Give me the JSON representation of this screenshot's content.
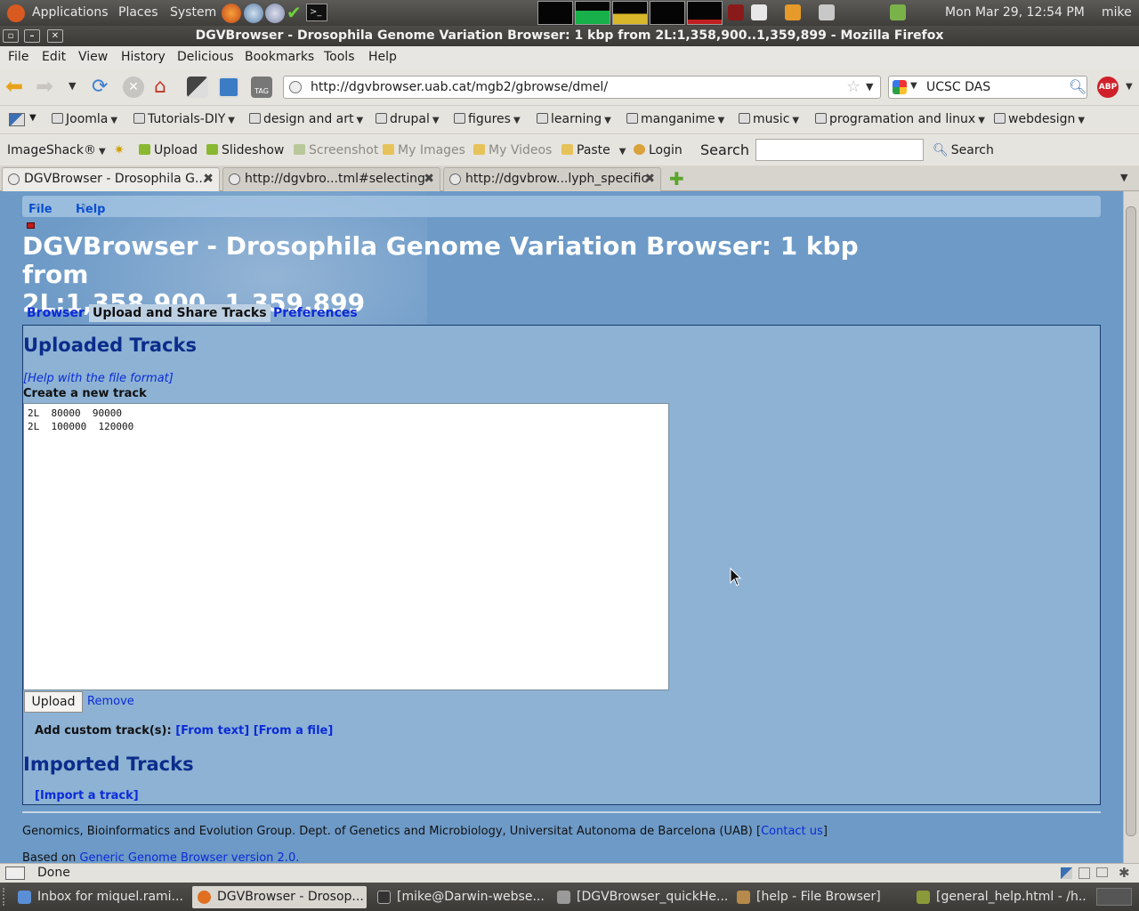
{
  "gnome_top": {
    "menus": [
      "Applications",
      "Places",
      "System"
    ],
    "clock": "Mon Mar 29, 12:54 PM",
    "user": "mike"
  },
  "window": {
    "title": "DGVBrowser - Drosophila Genome Variation Browser: 1 kbp from 2L:1,358,900..1,359,899 - Mozilla Firefox"
  },
  "menubar": [
    "File",
    "Edit",
    "View",
    "History",
    "Delicious",
    "Bookmarks",
    "Tools",
    "Help"
  ],
  "nav": {
    "url": "http://dgvbrowser.uab.cat/mgb2/gbrowse/dmel/",
    "search_engine_value": "UCSC DAS",
    "adblock_label": "ABP"
  },
  "bookmarks": [
    "Joomla",
    "Tutorials-DIY",
    "design and art",
    "drupal",
    "figures",
    "learning",
    "manganime",
    "music",
    "programation and linux",
    "webdesign"
  ],
  "imageshack": {
    "brand": "ImageShack®",
    "upload": "Upload",
    "slideshow": "Slideshow",
    "screenshot": "Screenshot",
    "my_images": "My Images",
    "my_videos": "My Videos",
    "paste": "Paste",
    "login": "Login",
    "search_label": "Search",
    "search_button": "Search"
  },
  "tabs": [
    {
      "label": "DGVBrowser - Drosophila G..."
    },
    {
      "label": "http://dgvbro...tml#selecting"
    },
    {
      "label": "http://dgvbrow...lyph_specific"
    }
  ],
  "page": {
    "menu_file": "File",
    "menu_help": "Help",
    "title_line1": "DGVBrowser - Drosophila Genome Variation Browser: 1 kbp from",
    "title_line2": "2L:1,358,900..1,359,899",
    "tab_browser": "Browser",
    "tab_upload": "Upload and Share Tracks",
    "tab_prefs": "Preferences",
    "uploaded_heading": "Uploaded Tracks",
    "help_format": "[Help with the file format]",
    "create_label": "Create a new track",
    "textarea_line1": "2L  80000  90000",
    "textarea_line2": "2L  100000  120000",
    "upload_button": "Upload",
    "remove_link": "Remove",
    "add_custom": "Add custom track(s):",
    "from_text": "[From text]",
    "from_file": "[From a file]",
    "imported_heading": "Imported Tracks",
    "import_link": "[Import a track]",
    "footer_text": "Genomics, Bioinformatics and Evolution Group. Dept. of Genetics and Microbiology, Universitat Autonoma de Barcelona (UAB) [",
    "footer_contact": "Contact us",
    "footer_end": "]",
    "based_on": "Based on ",
    "based_link": "Generic Genome Browser version 2.0."
  },
  "status": {
    "text": "Done"
  },
  "taskbar": [
    {
      "label": "Inbox for miquel.rami...",
      "color": "#5a8fd6"
    },
    {
      "label": "DGVBrowser - Drosop...",
      "color": "#e07020"
    },
    {
      "label": "[mike@Darwin-webse...",
      "color": "#333333"
    },
    {
      "label": "[DGVBrowser_quickHe...",
      "color": "#9a9a9a"
    },
    {
      "label": "[help - File Browser]",
      "color": "#b58a4a"
    },
    {
      "label": "[general_help.html - /h...",
      "color": "#8a9a3a"
    }
  ]
}
